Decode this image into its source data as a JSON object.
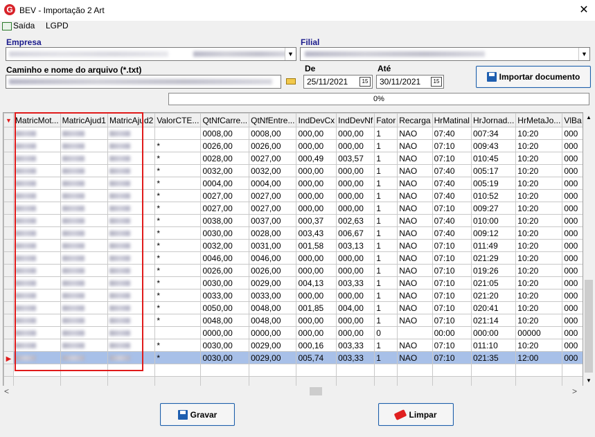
{
  "window": {
    "title": "BEV - Importação 2 Art",
    "app_icon_letter": "G",
    "close_glyph": "✕"
  },
  "menu": {
    "items": [
      {
        "label": "Saída",
        "icon": "exit-icon"
      },
      {
        "label": "LGPD"
      }
    ]
  },
  "form": {
    "empresa_label": "Empresa",
    "filial_label": "Filial",
    "file_label": "Caminho e nome do arquivo (*.txt)",
    "de_label": "De",
    "ate_label": "Até",
    "de_value": "25/11/2021",
    "ate_value": "30/11/2021",
    "cal_glyph": "15"
  },
  "buttons": {
    "importar": "Importar documento",
    "gravar": "Gravar",
    "limpar": "Limpar"
  },
  "progress": {
    "text": "0%",
    "value": 0
  },
  "grid": {
    "columns": [
      "MatricMot...",
      "MatricAjud1",
      "MatricAjud2",
      "ValorCTE...",
      "QtNfCarre...",
      "QtNfEntre...",
      "IndDevCx",
      "IndDevNf",
      "Fator",
      "Recarga",
      "HrMatinal",
      "HrJornad...",
      "HrMetaJo...",
      "VlBa"
    ],
    "rows": [
      [
        "",
        "0008,00",
        "0008,00",
        "000,00",
        "000,00",
        "1",
        "NAO",
        "07:40",
        "007:34",
        "10:20",
        "000"
      ],
      [
        "*",
        "0026,00",
        "0026,00",
        "000,00",
        "000,00",
        "1",
        "NAO",
        "07:10",
        "009:43",
        "10:20",
        "000"
      ],
      [
        "*",
        "0028,00",
        "0027,00",
        "000,49",
        "003,57",
        "1",
        "NAO",
        "07:10",
        "010:45",
        "10:20",
        "000"
      ],
      [
        "*",
        "0032,00",
        "0032,00",
        "000,00",
        "000,00",
        "1",
        "NAO",
        "07:40",
        "005:17",
        "10:20",
        "000"
      ],
      [
        "*",
        "0004,00",
        "0004,00",
        "000,00",
        "000,00",
        "1",
        "NAO",
        "07:40",
        "005:19",
        "10:20",
        "000"
      ],
      [
        "*",
        "0027,00",
        "0027,00",
        "000,00",
        "000,00",
        "1",
        "NAO",
        "07:40",
        "010:52",
        "10:20",
        "000"
      ],
      [
        "*",
        "0027,00",
        "0027,00",
        "000,00",
        "000,00",
        "1",
        "NAO",
        "07:10",
        "009:27",
        "10:20",
        "000"
      ],
      [
        "*",
        "0038,00",
        "0037,00",
        "000,37",
        "002,63",
        "1",
        "NAO",
        "07:40",
        "010:00",
        "10:20",
        "000"
      ],
      [
        "*",
        "0030,00",
        "0028,00",
        "003,43",
        "006,67",
        "1",
        "NAO",
        "07:40",
        "009:12",
        "10:20",
        "000"
      ],
      [
        "*",
        "0032,00",
        "0031,00",
        "001,58",
        "003,13",
        "1",
        "NAO",
        "07:10",
        "011:49",
        "10:20",
        "000"
      ],
      [
        "*",
        "0046,00",
        "0046,00",
        "000,00",
        "000,00",
        "1",
        "NAO",
        "07:10",
        "021:29",
        "10:20",
        "000"
      ],
      [
        "*",
        "0026,00",
        "0026,00",
        "000,00",
        "000,00",
        "1",
        "NAO",
        "07:10",
        "019:26",
        "10:20",
        "000"
      ],
      [
        "*",
        "0030,00",
        "0029,00",
        "004,13",
        "003,33",
        "1",
        "NAO",
        "07:10",
        "021:05",
        "10:20",
        "000"
      ],
      [
        "*",
        "0033,00",
        "0033,00",
        "000,00",
        "000,00",
        "1",
        "NAO",
        "07:10",
        "021:20",
        "10:20",
        "000"
      ],
      [
        "*",
        "0050,00",
        "0048,00",
        "001,85",
        "004,00",
        "1",
        "NAO",
        "07:10",
        "020:41",
        "10:20",
        "000"
      ],
      [
        "*",
        "0048,00",
        "0048,00",
        "000,00",
        "000,00",
        "1",
        "NAO",
        "07:10",
        "021:14",
        "10:20",
        "000"
      ],
      [
        "",
        "0000,00",
        "0000,00",
        "000,00",
        "000,00",
        "0",
        "",
        "00:00",
        "000:00",
        "00000",
        "000"
      ],
      [
        "*",
        "0030,00",
        "0029,00",
        "000,16",
        "003,33",
        "1",
        "NAO",
        "07:10",
        "011:10",
        "10:20",
        "000"
      ],
      [
        "*",
        "0030,00",
        "0029,00",
        "005,74",
        "003,33",
        "1",
        "NAO",
        "07:10",
        "021:35",
        "12:00",
        "000"
      ]
    ],
    "selected_row": 18,
    "indicator_glyph": "▶",
    "header_indicator": "▼"
  },
  "colors": {
    "highlight_frame": "#e01a1a",
    "selected_row": "#a8c0e8",
    "label_blue": "#1a1a8c"
  },
  "scroll": {
    "up": "▲",
    "down": "▼",
    "left": "<",
    "right": ">"
  }
}
